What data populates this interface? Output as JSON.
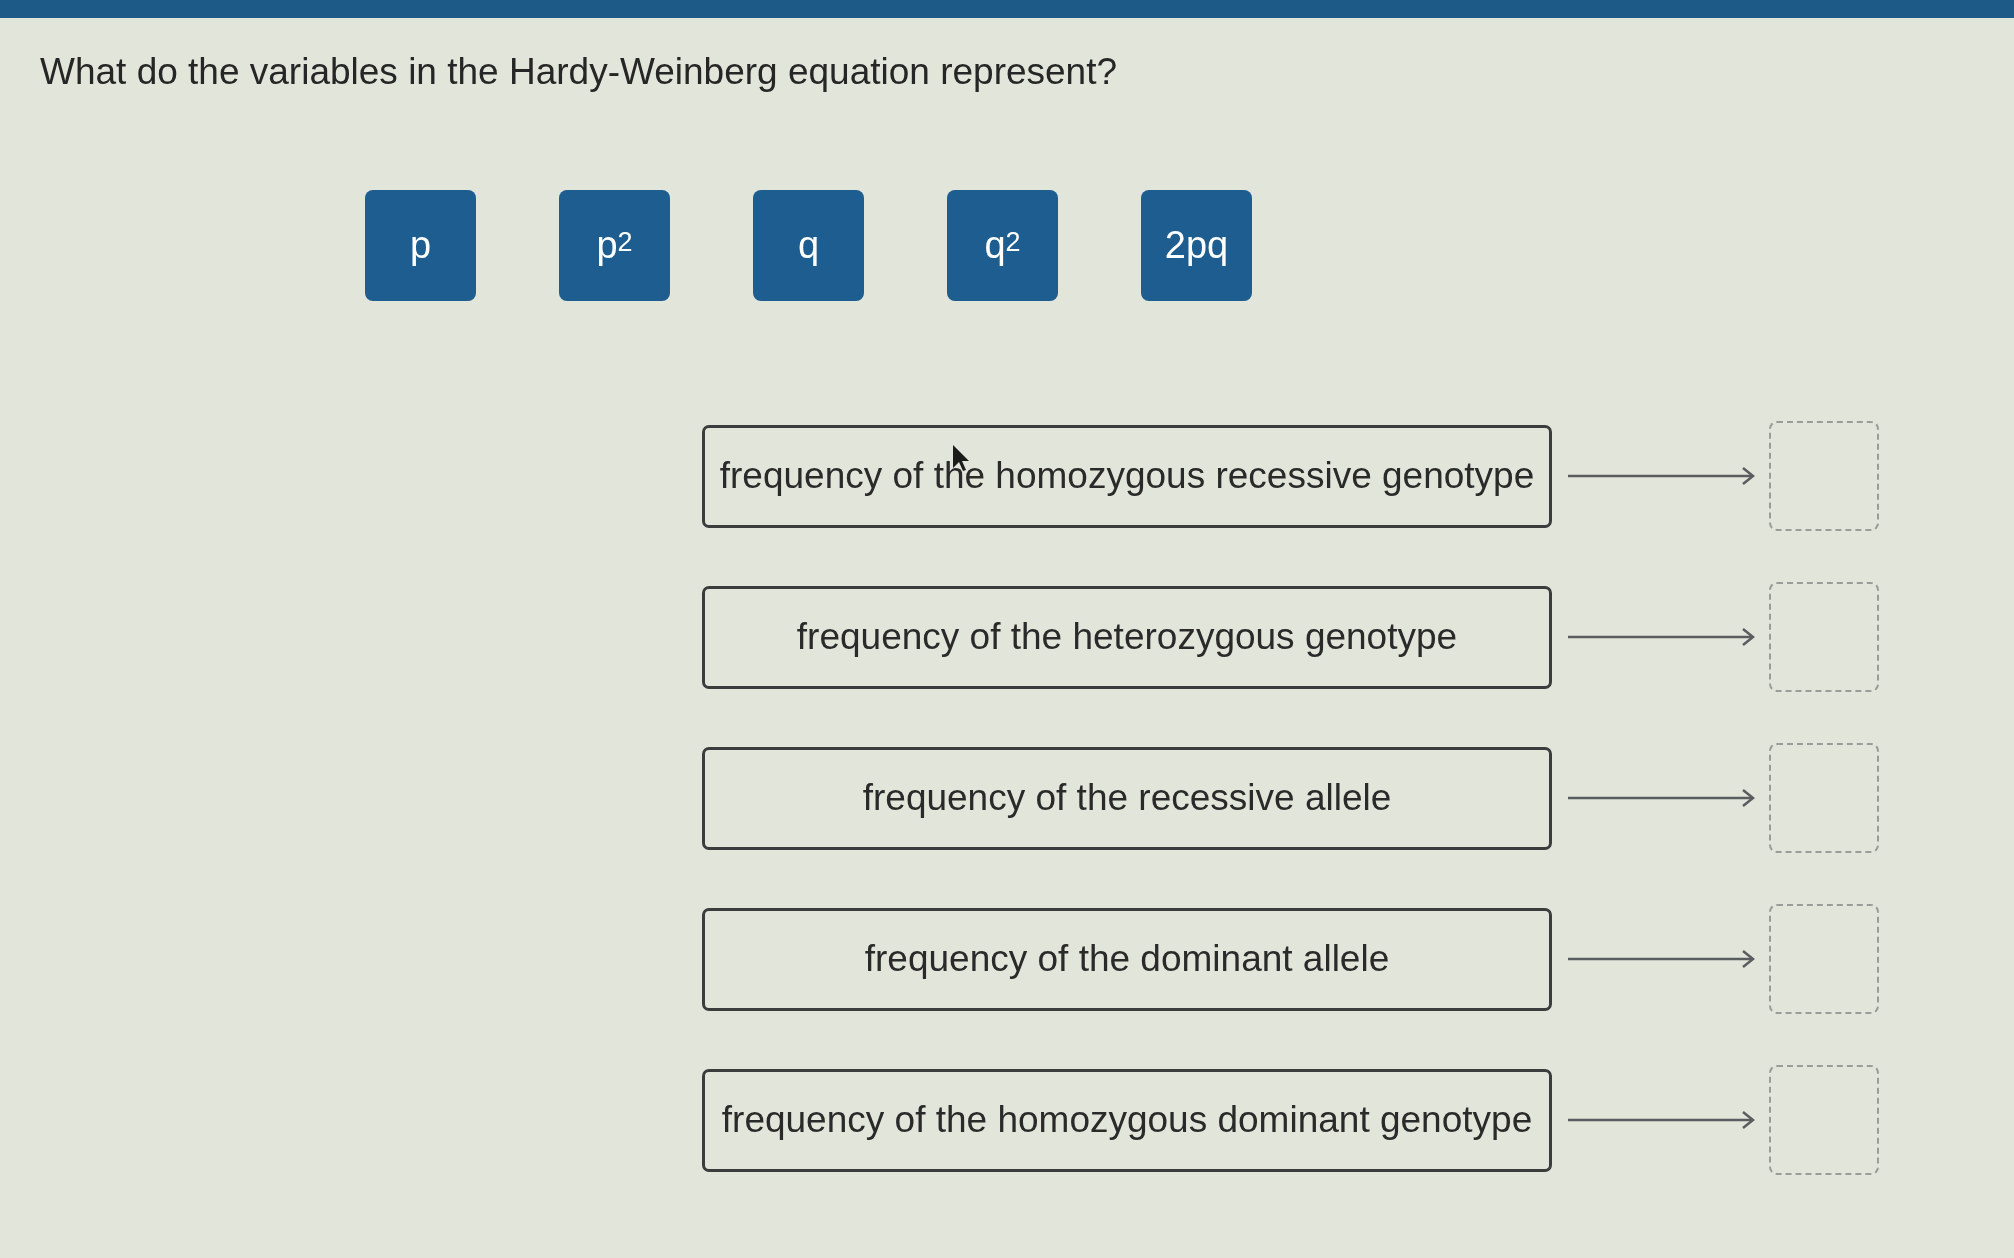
{
  "question": "What do the variables in the Hardy-Weinberg equation represent?",
  "answer_tiles": [
    "p",
    "p$^{2}$",
    "q",
    "q$^{2}$",
    "2pq"
  ],
  "match_rows": [
    {
      "description": "frequency of the homozygous recessive genotype"
    },
    {
      "description": "frequency of the heterozygous genotype"
    },
    {
      "description": "frequency of the recessive allele"
    },
    {
      "description": "frequency of the dominant allele"
    },
    {
      "description": "frequency of the homozygous dominant genotype"
    }
  ]
}
